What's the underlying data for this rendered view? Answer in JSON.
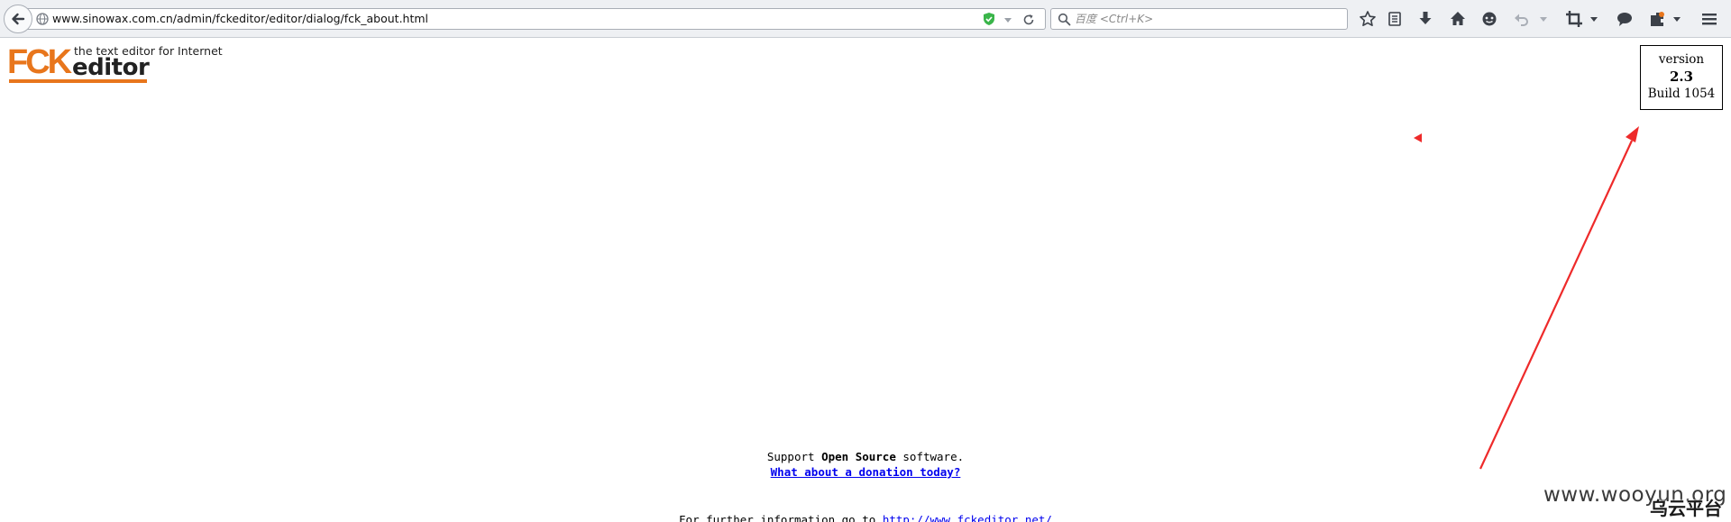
{
  "browser": {
    "url": "www.sinowax.com.cn/admin/fckeditor/editor/dialog/fck_about.html",
    "search_placeholder": "百度 <Ctrl+K>",
    "toolbar_icons": [
      "bookmark-star-icon",
      "reading-list-icon",
      "download-icon",
      "home-icon",
      "chat-icon",
      "undo-icon",
      "crop-icon",
      "comment-icon",
      "extension-icon",
      "menu-icon"
    ]
  },
  "logo": {
    "mark": "FCK",
    "tagline": "the text editor for Internet",
    "word": "editor"
  },
  "version_box": {
    "label": "version",
    "number": "2.3",
    "build": "Build 1054"
  },
  "support": {
    "prefix": "Support",
    "bold": "Open Source",
    "suffix": "software.",
    "donation_text": "What about a donation today?"
  },
  "more_info": {
    "text": "For further information go to",
    "link": "http://www.fckeditor.net/"
  },
  "watermark": {
    "site": "www.wooyun.org",
    "cn": "乌云平台"
  },
  "colors": {
    "brand_orange": "#e8761c",
    "annotation_red": "#ee2a2a",
    "link_blue": "#0000ee"
  }
}
